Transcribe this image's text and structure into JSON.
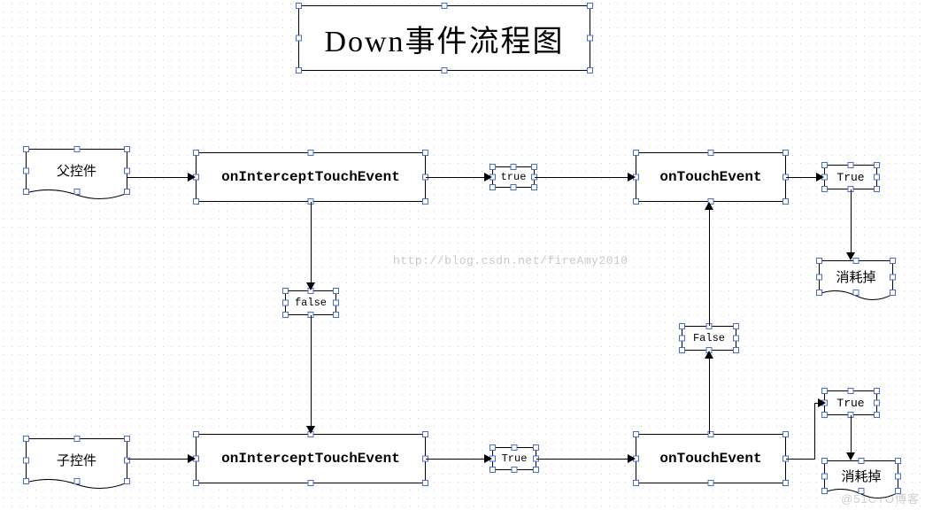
{
  "title": "Down事件流程图",
  "watermark": "http://blog.csdn.net/fireAmy2010",
  "corner_mark": "@51CTO博客",
  "nodes": {
    "parent_doc": "父控件",
    "child_doc": "子控件",
    "parent_intercept": "onInterceptTouchEvent",
    "child_intercept": "onInterceptTouchEvent",
    "parent_touch": "onTouchEvent",
    "child_touch": "onTouchEvent",
    "cond_true_top": "true",
    "cond_false_mid": "false",
    "cond_true_bottom": "True",
    "cond_false_right": "False",
    "out_true_top": "True",
    "out_consume_top": "消耗掉",
    "out_true_bottom": "True",
    "out_consume_bottom": "消耗掉"
  },
  "chart_data": {
    "type": "flowchart",
    "title": "Down事件流程图",
    "nodes": [
      {
        "id": "parent_doc",
        "kind": "document",
        "label": "父控件"
      },
      {
        "id": "parent_intercept",
        "kind": "process",
        "label": "onInterceptTouchEvent"
      },
      {
        "id": "cond_true_top",
        "kind": "decision",
        "label": "true"
      },
      {
        "id": "parent_touch",
        "kind": "process",
        "label": "onTouchEvent"
      },
      {
        "id": "out_true_top",
        "kind": "terminator",
        "label": "True"
      },
      {
        "id": "out_consume_top",
        "kind": "terminator",
        "label": "消耗掉"
      },
      {
        "id": "cond_false_mid",
        "kind": "decision",
        "label": "false"
      },
      {
        "id": "child_doc",
        "kind": "document",
        "label": "子控件"
      },
      {
        "id": "child_intercept",
        "kind": "process",
        "label": "onInterceptTouchEvent"
      },
      {
        "id": "cond_true_bottom",
        "kind": "decision",
        "label": "True"
      },
      {
        "id": "child_touch",
        "kind": "process",
        "label": "onTouchEvent"
      },
      {
        "id": "cond_false_right",
        "kind": "decision",
        "label": "False"
      },
      {
        "id": "out_true_bottom",
        "kind": "terminator",
        "label": "True"
      },
      {
        "id": "out_consume_bottom",
        "kind": "terminator",
        "label": "消耗掉"
      }
    ],
    "edges": [
      {
        "from": "parent_doc",
        "to": "parent_intercept"
      },
      {
        "from": "parent_intercept",
        "to": "cond_true_top"
      },
      {
        "from": "cond_true_top",
        "to": "parent_touch"
      },
      {
        "from": "parent_touch",
        "to": "out_true_top"
      },
      {
        "from": "out_true_top",
        "to": "out_consume_top"
      },
      {
        "from": "parent_intercept",
        "to": "cond_false_mid"
      },
      {
        "from": "cond_false_mid",
        "to": "child_intercept"
      },
      {
        "from": "child_doc",
        "to": "child_intercept"
      },
      {
        "from": "child_intercept",
        "to": "cond_true_bottom"
      },
      {
        "from": "cond_true_bottom",
        "to": "child_touch"
      },
      {
        "from": "child_touch",
        "to": "cond_false_right"
      },
      {
        "from": "cond_false_right",
        "to": "parent_touch"
      },
      {
        "from": "child_touch",
        "to": "out_true_bottom"
      },
      {
        "from": "out_true_bottom",
        "to": "out_consume_bottom"
      }
    ]
  }
}
